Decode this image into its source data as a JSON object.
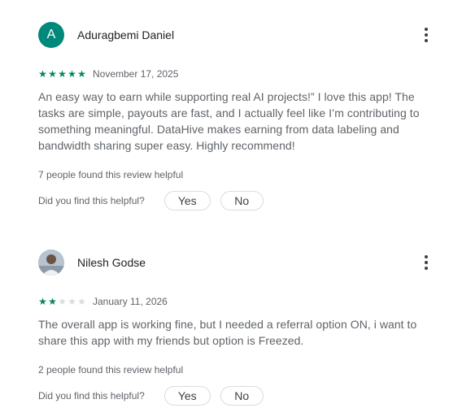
{
  "reviews": [
    {
      "author": "Aduragbemi Daniel",
      "avatar_initial": "A",
      "avatar_color": "#00897b",
      "rating": 5,
      "max_rating": 5,
      "date": "November 17, 2025",
      "text": "An easy way to earn while supporting real AI projects!” I love this app! The tasks are simple, payouts are fast, and I actually feel like I’m contributing to something meaningful. DataHive makes earning from data labeling and bandwidth sharing super easy. Highly recommend!",
      "helpful_count_text": "7 people found this review helpful",
      "helpful_question": "Did you find this helpful?",
      "yes_label": "Yes",
      "no_label": "No"
    },
    {
      "author": "Nilesh Godse",
      "avatar_initial": "",
      "avatar_color": "#c9cfd6",
      "rating": 2,
      "max_rating": 5,
      "date": "January 11, 2026",
      "text": "The overall app is working fine, but I needed a referral option ON, i want to share this app with my friends but option is Freezed.",
      "helpful_count_text": "2 people found this review helpful",
      "helpful_question": "Did you find this helpful?",
      "yes_label": "Yes",
      "no_label": "No"
    }
  ],
  "colors": {
    "star_filled": "#01875f",
    "star_empty": "#dadce0",
    "secondary_text": "#5f6368"
  },
  "icons": {
    "menu": "more-vert-icon",
    "star": "star-icon"
  }
}
